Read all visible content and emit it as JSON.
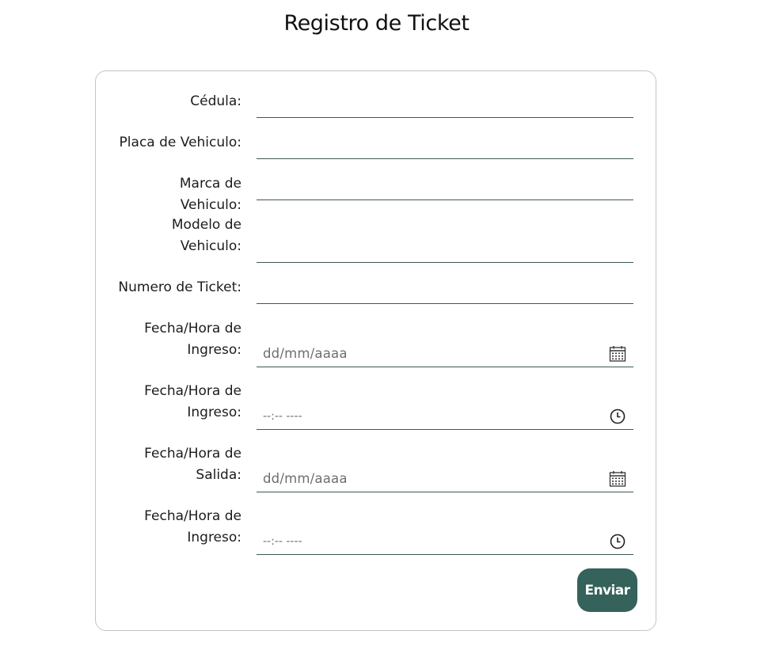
{
  "page": {
    "title": "Registro de Ticket"
  },
  "form": {
    "fields": [
      {
        "label": "Cédula:",
        "type": "text",
        "value": "",
        "placeholder": ""
      },
      {
        "label": "Placa de Vehiculo:",
        "type": "text",
        "value": "",
        "placeholder": ""
      },
      {
        "label": "Marca de Vehiculo:",
        "type": "text",
        "value": "",
        "placeholder": ""
      },
      {
        "label": "Modelo de Vehiculo:",
        "type": "text",
        "value": "",
        "placeholder": ""
      },
      {
        "label": "Numero de Ticket:",
        "type": "text",
        "value": "",
        "placeholder": ""
      },
      {
        "label": "Fecha/Hora de Ingreso:",
        "type": "date",
        "value": "",
        "placeholder": "dd/mm/aaaa",
        "icon": "calendar-icon"
      },
      {
        "label": "Fecha/Hora de Ingreso:",
        "type": "time",
        "value": "",
        "placeholder": "--:-- ----",
        "icon": "clock-icon"
      },
      {
        "label": "Fecha/Hora de Salida:",
        "type": "date",
        "value": "",
        "placeholder": "dd/mm/aaaa",
        "icon": "calendar-icon"
      },
      {
        "label": "Fecha/Hora de Ingreso:",
        "type": "time",
        "value": "",
        "placeholder": "--:-- ----",
        "icon": "clock-icon"
      }
    ],
    "submit_label": "Enviar"
  },
  "colors": {
    "accent": "#35625a",
    "underline": "#3e5a4f",
    "card_border": "#c4c4c4",
    "placeholder": "#6e6e6e"
  }
}
